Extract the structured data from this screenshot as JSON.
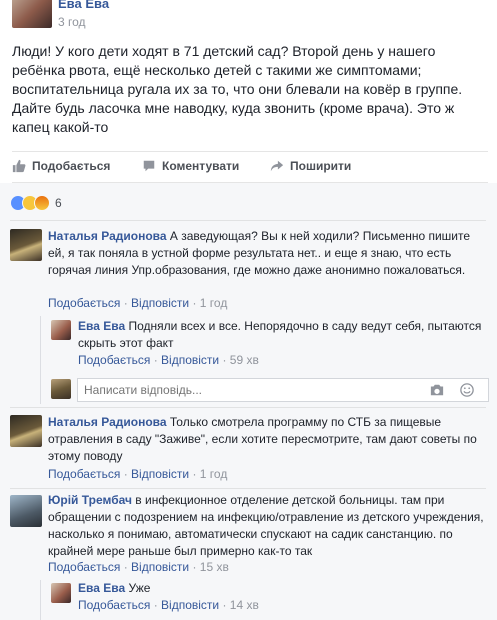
{
  "post": {
    "author": "Ева Ева",
    "time": "3 год",
    "text": "Люди! У кого дети ходят в 71 детский сад? Второй день у нашего ребёнка рвота, ещё несколько детей с такими же симптомами; воспитательница ругала их за то, что они блевали на ковёр в группе. Дайте будь ласочка мне наводку, куда звонить (кроме врача). Это ж капец какой-то"
  },
  "actions": {
    "like": "Подобається",
    "comment": "Коментувати",
    "share": "Поширити"
  },
  "reactions": {
    "count": "6"
  },
  "comments": [
    {
      "author": "Наталья Радионова",
      "text": "А заведующая? Вы к ней ходили? Письменно пишите ей, я так поняла в устной форме результата нет.. и еще я знаю, что есть горячая линия Упр.образования, где можно даже анонимно пожаловаться.",
      "like": "Подобається",
      "reply": "Відповісти",
      "time": "1 год",
      "replies": [
        {
          "author": "Ева Ева",
          "text": "Подняли всех и все. Непорядочно в саду ведут себя, пытаются скрыть этот факт",
          "like": "Подобається",
          "reply": "Відповісти",
          "time": "59 хв"
        }
      ]
    },
    {
      "author": "Наталья Радионова",
      "text": "Только смотрела программу по СТБ за пищевые отравления в саду \"Заживе\", если хотите пересмотрите, там дают советы по этому поводу",
      "like": "Подобається",
      "reply": "Відповісти",
      "time": "1 год"
    },
    {
      "author": "Юрій Трембач",
      "text": "в инфекционное отделение детской больницы. там при обращении с подозрением на инфекцию/отравление из детского учреждения, насколько я понимаю, автоматически спускают на садик санстанцию. по крайней мере раньше был примерно как-то так",
      "like": "Подобається",
      "reply": "Відповісти",
      "time": "15 хв",
      "replies": [
        {
          "author": "Ева Ева",
          "text": "Уже",
          "like": "Подобається",
          "reply": "Відповісти",
          "time": "14 хв"
        }
      ]
    }
  ],
  "reply_input": {
    "placeholder": "Написати відповідь..."
  },
  "colors": {
    "link": "#365899",
    "meta": "#90949c",
    "background": "#f6f7f9"
  },
  "icons": [
    "thumbs-up-icon",
    "comment-icon",
    "share-icon",
    "camera-icon",
    "smiley-icon"
  ]
}
